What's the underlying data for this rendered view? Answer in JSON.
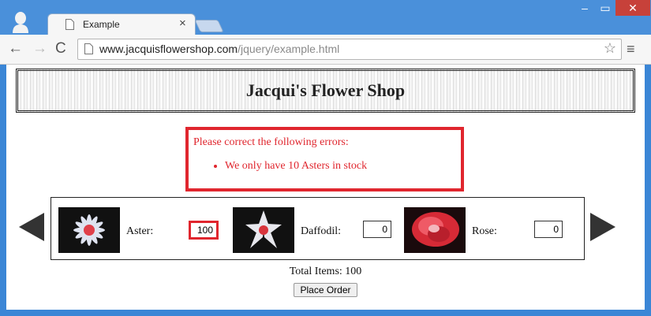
{
  "browser": {
    "tab_title": "Example",
    "tab_close": "×",
    "url_host": "www.jacquisflowershop.com",
    "url_path": "/jquery/example.html",
    "star": "☆",
    "menu": "≡",
    "back": "←",
    "forward": "→",
    "reload": "C",
    "minimize": "–",
    "maximize": "▭",
    "close": "✕"
  },
  "page": {
    "title": "Jacqui's Flower Shop",
    "errors": {
      "heading": "Please correct the following errors:",
      "items": [
        "We only have 10 Asters in stock"
      ]
    },
    "products": [
      {
        "name": "Aster:",
        "quantity": "100",
        "invalid": true
      },
      {
        "name": "Daffodil:",
        "quantity": "0",
        "invalid": false
      },
      {
        "name": "Rose:",
        "quantity": "0",
        "invalid": false
      }
    ],
    "total_label": "Total Items: 100",
    "order_button": "Place Order"
  },
  "colors": {
    "error_red": "#e0262e",
    "window_blue": "#4a90da"
  }
}
